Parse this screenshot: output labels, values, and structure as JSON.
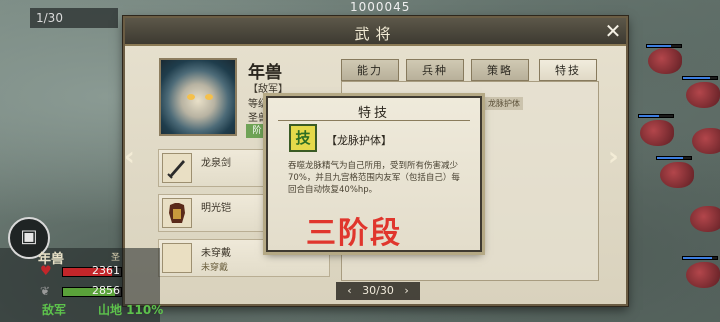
{
  "hud_top": {
    "turn_counter": "1/30",
    "top_number": "1000045"
  },
  "window": {
    "title": "武将",
    "close_icon": "close-x-icon"
  },
  "general": {
    "name": "年兽",
    "faction_tag": "【敌军】",
    "level_label": "等级",
    "holy_label": "圣兽",
    "badge": "阶"
  },
  "equipment": [
    {
      "name": "龙泉剑",
      "sub": "",
      "icon": "sword-icon"
    },
    {
      "name": "明光铠",
      "sub": "",
      "icon": "armor-icon"
    },
    {
      "name": "未穿戴",
      "sub": "未穿戴",
      "icon": "empty-slot-icon"
    }
  ],
  "tabs": [
    {
      "label": "能力",
      "active": false
    },
    {
      "label": "兵种",
      "active": false
    },
    {
      "label": "策略",
      "active": false
    },
    {
      "label": "特技",
      "active": true
    }
  ],
  "panel_chip": "龙脉护体",
  "popup": {
    "title": "特技",
    "skill_icon_glyph": "技",
    "skill_name": "【龙脉护体】",
    "description": "吞噬龙脉精气为自己所用，受到所有伤害减少70%，并且九宫格范围内友军（包括自己）每回合自动恢复40%hp。"
  },
  "stage_label": "三阶段",
  "pager": {
    "prev": "‹",
    "text": "30/30",
    "next": "›"
  },
  "unit_hud": {
    "name": "年兽",
    "extra": "圣",
    "hp": "2361",
    "mp": "2856",
    "camp": "敌军",
    "terrain": "山地 110%"
  },
  "colors": {
    "stage_red": "#e0362d",
    "camp_green": "#5dc24c"
  }
}
